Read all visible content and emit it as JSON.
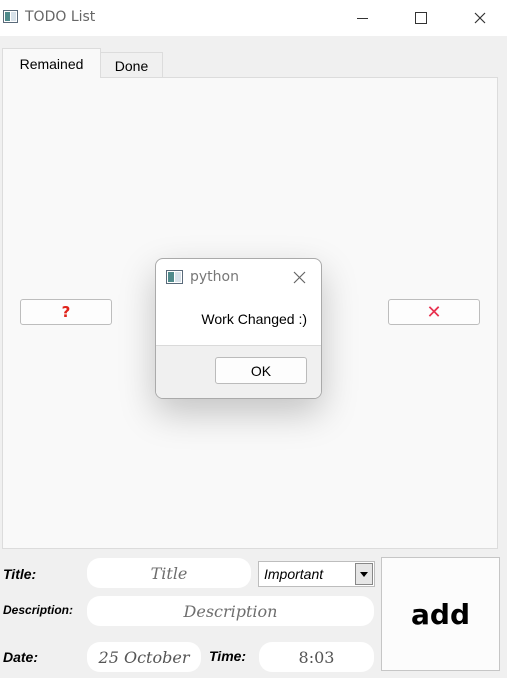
{
  "window": {
    "title": "TODO List",
    "icon": "app-window-icon",
    "controls": [
      "minimize-icon",
      "maximize-icon",
      "close-icon"
    ]
  },
  "tabs": [
    {
      "label": "Remained",
      "selected": true
    },
    {
      "label": "Done",
      "selected": false
    }
  ],
  "tab_content": {
    "left_button": {
      "glyph": "?",
      "icon": "question-icon",
      "color": "#e0231b"
    },
    "right_button": {
      "glyph": "✕",
      "icon": "delete-x-icon",
      "color": "#e8304e"
    }
  },
  "dialog": {
    "title": "python",
    "message": "Work Changed :)",
    "ok_label": "OK"
  },
  "form": {
    "title_label": "Title:",
    "title_placeholder": "Title",
    "priority_value": "Important",
    "description_label": "Description:",
    "description_placeholder": "Description",
    "date_label": "Date:",
    "date_value": "25 October",
    "time_label": "Time:",
    "time_value": "8:03",
    "add_label": "add"
  }
}
